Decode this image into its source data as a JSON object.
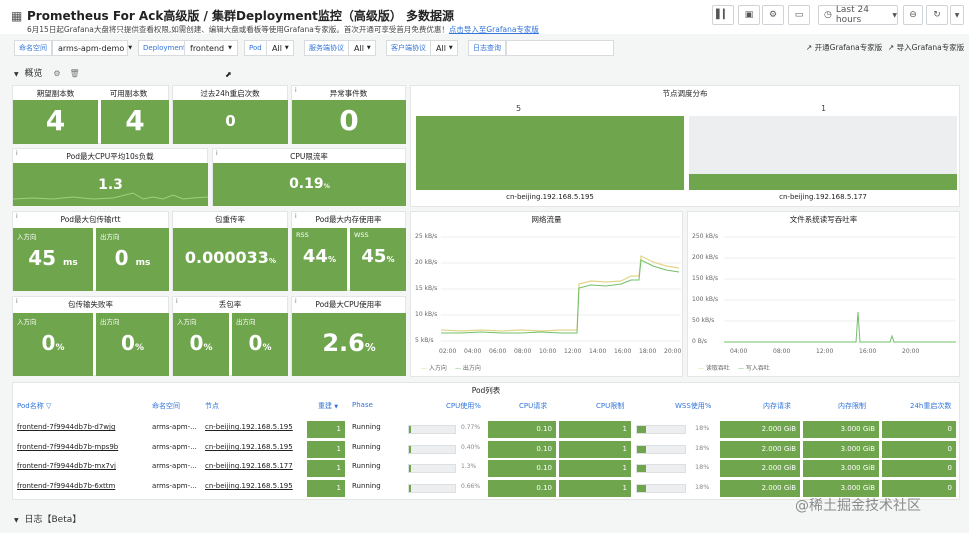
{
  "header": {
    "title": "Prometheus For Ack高级版 / 集群Deployment监控（高级版） 多数据源",
    "notice": "6月15日起Grafana大盘将只提供查看权限,如需创建、编辑大盘或看板等使用Grafana专家版。首次开通可享受首月免费优惠！",
    "notice_link": "点击导入至Grafana专家版",
    "time_range": "Last 24 hours"
  },
  "vars": {
    "namespace_label": "命名空间",
    "namespace_value": "arms-apm-demo",
    "deployment_label": "Deployment",
    "deployment_value": "frontend",
    "pod_label": "Pod",
    "pod_value": "All",
    "proto_label": "服务端协议",
    "proto_value": "All",
    "client_label": "客户端协议",
    "client_value": "All",
    "log_label": "日志查询",
    "open_expert": "开通Grafana专家版",
    "import_expert": "导入Grafana专家版"
  },
  "section": {
    "overview": "概览",
    "logs": "日志【Beta】"
  },
  "stats": {
    "desired_title": "期望副本数",
    "desired": "4",
    "available_title": "可用副本数",
    "available": "4",
    "restarts_title": "过去24h重启次数",
    "restarts": "0",
    "events_title": "异常事件数",
    "events": "0",
    "cpu_load_title": "Pod最大CPU平均10s负载",
    "cpu_load": "1.3",
    "cpu_throttle_title": "CPU限流率",
    "cpu_throttle": "0.19",
    "cpu_throttle_unit": "%",
    "rtt_title": "Pod最大包传输rtt",
    "in_label": "入方向",
    "out_label": "出方向",
    "rtt_in": "45",
    "rtt_in_unit": "ms",
    "rtt_out": "0",
    "rtt_out_unit": "ms",
    "retrans_title": "包重传率",
    "retrans": "0.000033",
    "retrans_unit": "%",
    "mem_title": "Pod最大内存使用率",
    "rss_label": "RSS",
    "wss_label": "WSS",
    "rss": "44",
    "wss": "45",
    "pct_unit": "%",
    "loss_title": "包传输失败率",
    "loss_in": "0",
    "loss_out": "0",
    "drop_title": "丢包率",
    "drop_in": "0",
    "drop_out": "0",
    "maxcpu_title": "Pod最大CPU使用率",
    "maxcpu": "2.6"
  },
  "node_dist": {
    "title": "节点调度分布",
    "nodes": [
      {
        "count": "5",
        "name": "cn-beijing.192.168.5.195"
      },
      {
        "count": "1",
        "name": "cn-beijing.192.168.5.177"
      }
    ]
  },
  "net_chart": {
    "title": "网络流量",
    "y_ticks": [
      "25 kB/s",
      "20 kB/s",
      "15 kB/s",
      "10 kB/s",
      "5 kB/s"
    ],
    "x_ticks": [
      "02:00",
      "04:00",
      "06:00",
      "08:00",
      "10:00",
      "12:00",
      "14:00",
      "16:00",
      "18:00",
      "20:00"
    ],
    "legend_in": "入方向",
    "legend_out": "出方向"
  },
  "fs_chart": {
    "title": "文件系统读写吞吐率",
    "y_ticks": [
      "250 kB/s",
      "200 kB/s",
      "150 kB/s",
      "100 kB/s",
      "50 kB/s",
      "0 B/s"
    ],
    "x_ticks": [
      "04:00",
      "08:00",
      "12:00",
      "16:00",
      "20:00"
    ],
    "legend_read": "读取吞吐",
    "legend_write": "写入吞吐"
  },
  "pods": {
    "title": "Pod列表",
    "headers": [
      "Pod名称",
      "命名空间",
      "节点",
      "重建",
      "Phase",
      "CPU使用%",
      "CPU请求",
      "CPU限制",
      "WSS使用%",
      "内存请求",
      "内存限制",
      "24h重启次数"
    ],
    "rows": [
      {
        "name": "frontend-7f9944db7b-d7wjg",
        "ns": "arms-apm-...",
        "node": "cn-beijing.192.168.5.195",
        "rebuild": "1",
        "phase": "Running",
        "cpu_pct": "0.77%",
        "cpu_frac": 0.0077,
        "cpu_req": "0.10",
        "cpu_lim": "1",
        "wss": "18%",
        "wss_frac": 0.18,
        "mem_req": "2.000 GiB",
        "mem_lim": "3.000 GiB",
        "restarts": "0"
      },
      {
        "name": "frontend-7f9944db7b-mps9b",
        "ns": "arms-apm-...",
        "node": "cn-beijing.192.168.5.195",
        "rebuild": "1",
        "phase": "Running",
        "cpu_pct": "0.40%",
        "cpu_frac": 0.004,
        "cpu_req": "0.10",
        "cpu_lim": "1",
        "wss": "18%",
        "wss_frac": 0.18,
        "mem_req": "2.000 GiB",
        "mem_lim": "3.000 GiB",
        "restarts": "0"
      },
      {
        "name": "frontend-7f9944db7b-mx7vj",
        "ns": "arms-apm-...",
        "node": "cn-beijing.192.168.5.177",
        "rebuild": "1",
        "phase": "Running",
        "cpu_pct": "1.3%",
        "cpu_frac": 0.013,
        "cpu_req": "0.10",
        "cpu_lim": "1",
        "wss": "18%",
        "wss_frac": 0.18,
        "mem_req": "2.000 GiB",
        "mem_lim": "3.000 GiB",
        "restarts": "0"
      },
      {
        "name": "frontend-7f9944db7b-6xttm",
        "ns": "arms-apm-...",
        "node": "cn-beijing.192.168.5.195",
        "rebuild": "1",
        "phase": "Running",
        "cpu_pct": "0.66%",
        "cpu_frac": 0.0066,
        "cpu_req": "0.10",
        "cpu_lim": "1",
        "wss": "18%",
        "wss_frac": 0.18,
        "mem_req": "2.000 GiB",
        "mem_lim": "3.000 GiB",
        "restarts": "0"
      }
    ]
  },
  "watermark": "@稀土掘金技术社区",
  "colors": {
    "stat_green": "#6fa54d",
    "link_blue": "#3274d9",
    "line_yellow": "#e0d68a",
    "line_green": "#73bf69"
  }
}
